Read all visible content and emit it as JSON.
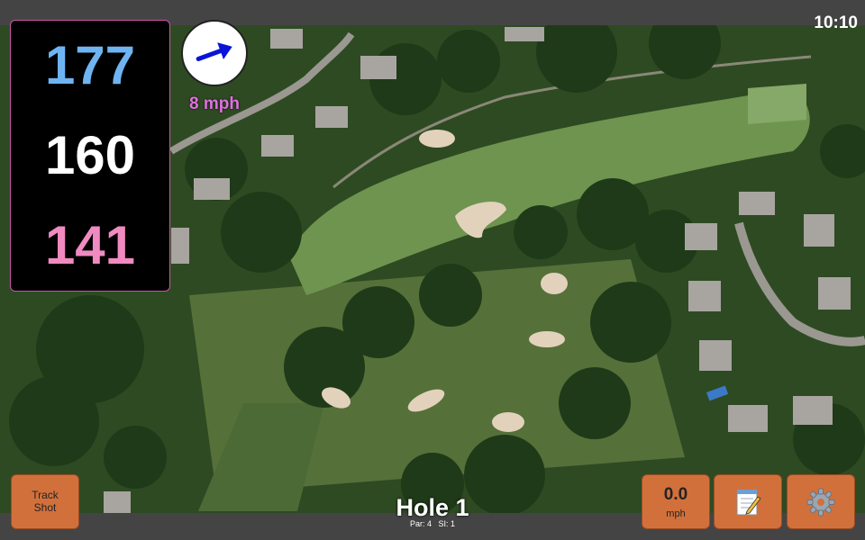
{
  "status": {
    "time": "10:10"
  },
  "distances": {
    "back": "177",
    "middle": "160",
    "front": "141",
    "colors": {
      "back": "#6fb4f2",
      "middle": "#ffffff",
      "front": "#f08ac0"
    }
  },
  "wind": {
    "speed_label": "8 mph",
    "direction_icon": "wind-arrow-icon",
    "direction": "east-north-east"
  },
  "buttons": {
    "track_shot_line1": "Track",
    "track_shot_line2": "Shot",
    "speed_value": "0.0",
    "speed_unit": "mph",
    "notes_icon": "notepad-icon",
    "settings_icon": "gear-icon"
  },
  "hole": {
    "title": "Hole 1",
    "subtitle": "Par: 4   SI: 1"
  },
  "colors": {
    "button": "#d2703c",
    "bar": "#444444",
    "distance_panel": "#000000"
  }
}
